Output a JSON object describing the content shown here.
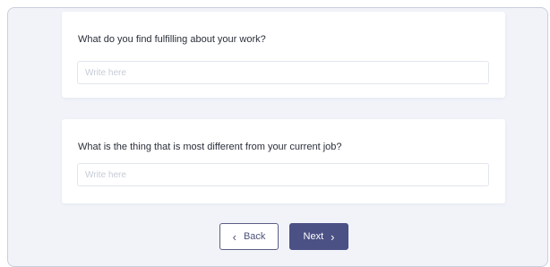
{
  "questions": [
    {
      "label": "What do you find fulfilling about your work?",
      "placeholder": "Write here",
      "value": ""
    },
    {
      "label": "What is the thing that is most different from your current job?",
      "placeholder": "Write here",
      "value": ""
    }
  ],
  "nav": {
    "back_label": "Back",
    "back_icon": "‹",
    "next_label": "Next",
    "next_icon": "›"
  },
  "colors": {
    "page_background": "#f1f3f9",
    "frame_border": "#c9cfdc",
    "primary_button": "#4b5085",
    "secondary_button_border": "#5a5f86",
    "question_text": "#2b2f3a",
    "placeholder_text": "#c6cbd6"
  }
}
